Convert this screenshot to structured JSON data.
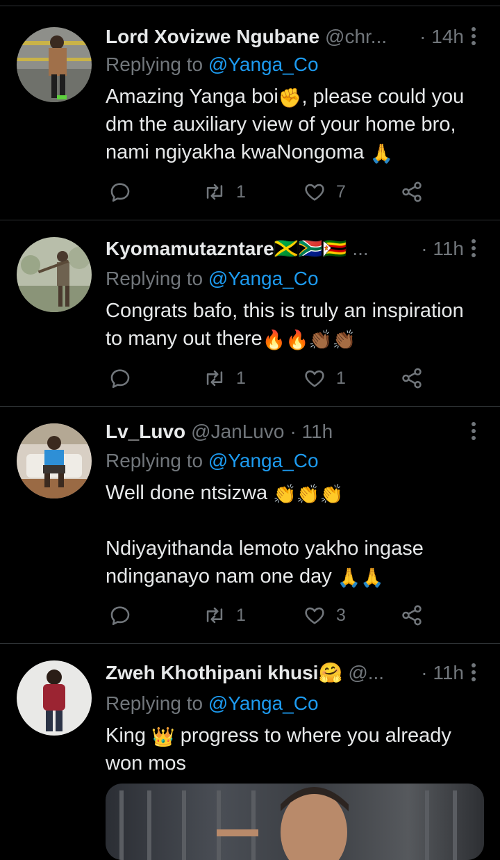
{
  "tweets": [
    {
      "name": "Lord Xovizwe Ngubane",
      "handle": "@chr...",
      "time": "· 14h",
      "replying_label": "Replying to",
      "replying_handle": "@Yanga_Co",
      "lines": [
        {
          "a": "Amazing Yanga boi",
          "e1": "✊",
          "b": ", please could you"
        },
        {
          "a": "dm the auxiliary view of your home bro,"
        },
        {
          "a": "nami ngiyakha kwaNongoma ",
          "e1": "🙏"
        }
      ],
      "retweets": "1",
      "likes": "7",
      "avatar_icon": "person-avatar"
    },
    {
      "name": "Kyomamutazntare🇯🇲🇿🇦🇿🇼",
      "handle": "...",
      "time": "· 11h",
      "replying_label": "Replying to",
      "replying_handle": "@Yanga_Co",
      "lines": [
        {
          "a": "Congrats bafo, this is truly an inspiration"
        },
        {
          "a": "to many out there",
          "e1": "🔥🔥👏🏾👏🏾"
        }
      ],
      "retweets": "1",
      "likes": "1",
      "avatar_icon": "person-avatar"
    },
    {
      "name": "Lv_Luvo",
      "handle": "@JanLuvo",
      "time": "· 11h",
      "replying_label": "Replying to",
      "replying_handle": "@Yanga_Co",
      "lines": [
        {
          "a": "Well done ntsizwa ",
          "e1": "👏👏👏"
        },
        {
          "a": ""
        },
        {
          "a": "Ndiyayithanda lemoto yakho ingase"
        },
        {
          "a": "ndinganayo nam one day ",
          "e1": "🙏🙏"
        }
      ],
      "retweets": "1",
      "likes": "3",
      "avatar_icon": "person-avatar"
    },
    {
      "name": "Zweh Khothipani khusi🤗",
      "handle": "@...",
      "time": "· 11h",
      "replying_label": "Replying to",
      "replying_handle": "@Yanga_Co",
      "lines": [
        {
          "a": "King ",
          "e1": "👑",
          "b": " progress to where you already"
        },
        {
          "a": "won mos"
        }
      ],
      "avatar_icon": "person-avatar"
    }
  ],
  "colors": {
    "background": "#000000",
    "text": "#e7e9ea",
    "secondary": "#71767b",
    "link": "#1d9bf0",
    "divider": "#2f3336"
  }
}
